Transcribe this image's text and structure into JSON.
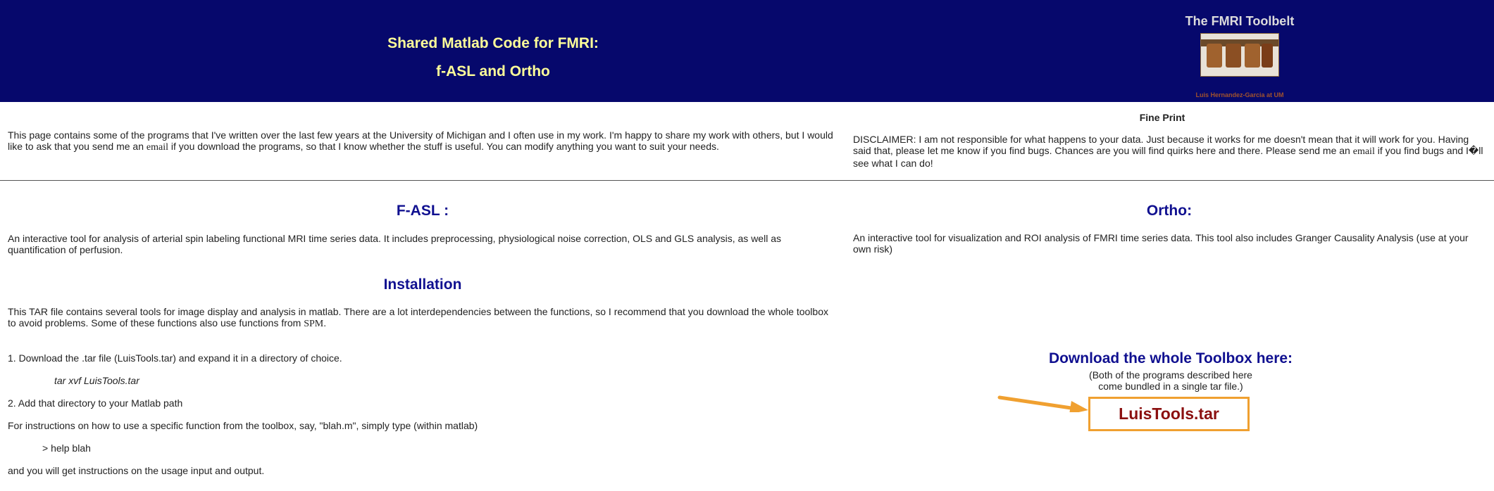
{
  "header": {
    "title_line1": "Shared Matlab Code for FMRI:",
    "title_line2": "f-ASL and Ortho",
    "toolbelt_title": "The FMRI Toolbelt",
    "credit": "Luis Hernandez-Garcia at UM"
  },
  "intro": {
    "text_before_link": "This page contains some of the programs that I've written over the last few years at the University of Michigan and I often use in my work.   I'm happy to share my work with others, but I would like to ask that you send me an ",
    "link": "email",
    "text_after_link": " if you download the programs, so that I know whether the stuff is useful.  You can modify anything you want to suit your needs."
  },
  "fine_print": {
    "title": "Fine Print",
    "text_before_link": "DISCLAIMER:   I am not responsible for what happens to your data. Just because it works for me doesn't mean that it will work for you.  Having said that, please let me know if you find bugs. Chances are you will find quirks here and there.  Please send me an ",
    "link": "email",
    "text_after_link": " if you find bugs and I�ll see what I can do!"
  },
  "fasl": {
    "heading": "F-ASL :",
    "text": "An interactive tool for analysis of arterial spin labeling functional MRI time series data.  It includes preprocessing, physiological noise correction, OLS and GLS analysis, as well as quantification of perfusion."
  },
  "ortho": {
    "heading": "Ortho:",
    "text": "An interactive tool for visualization and ROI analysis of FMRI time series data.  This tool also includes Granger Causality Analysis (use at your own risk)"
  },
  "installation": {
    "heading": "Installation",
    "text_before_link": "This TAR file contains several tools for image display and analysis in matlab. There are a lot interdependencies between the functions, so I recommend that you download the whole toolbox to avoid problems.  Some of these functions also use functions from ",
    "link": "SPM",
    "text_after_link": ".",
    "step1": "1.  Download the .tar file  (LuisTools.tar) and expand it in a directory of choice.",
    "step1_cmd": "tar xvf LuisTools.tar",
    "step2": "2.  Add that directory to your Matlab  path",
    "instructions": "For instructions on how to use a specific function from the toolbox, say, \"blah.m\", simply type (within matlab)",
    "help_cmd": "> help blah",
    "closing": "and you will get instructions on the usage input and output."
  },
  "download": {
    "title": "Download the whole Toolbox here:",
    "note_line1": "(Both of the programs described here",
    "note_line2": "come bundled in a single tar file.)",
    "file_link": "LuisTools.tar"
  },
  "colors": {
    "header_bg": "#06086c",
    "header_title": "#ffff99",
    "heading_blue": "#101090",
    "download_link": "#8b1010",
    "highlight_orange": "#f0a030"
  }
}
